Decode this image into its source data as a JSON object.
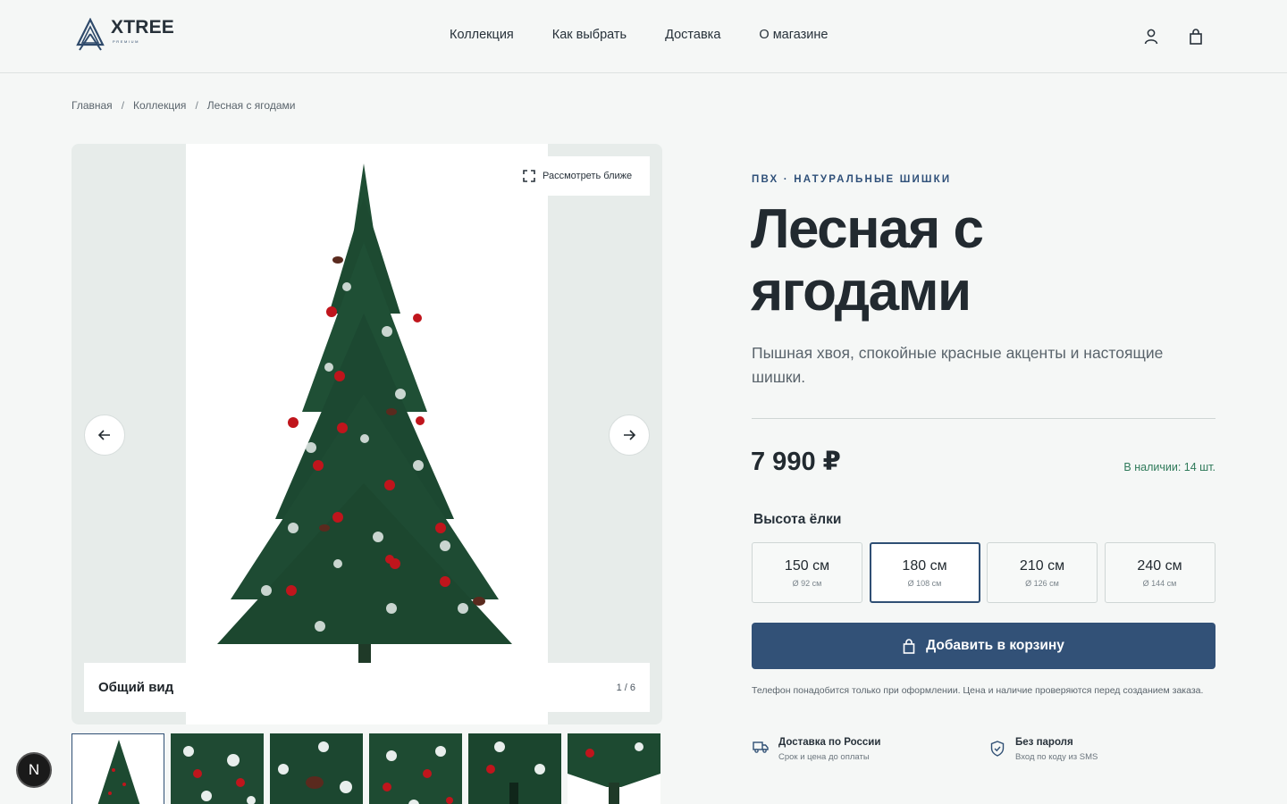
{
  "brand": {
    "name": "XTREE",
    "sub": "PREMIUM"
  },
  "nav": [
    {
      "label": "Коллекция"
    },
    {
      "label": "Как выбрать"
    },
    {
      "label": "Доставка"
    },
    {
      "label": "О магазине"
    }
  ],
  "header_icons": [
    "user-icon",
    "bag-icon"
  ],
  "breadcrumb": [
    "Главная",
    "Коллекция",
    "Лесная с ягодами"
  ],
  "gallery": {
    "zoom_label": "Рассмотреть ближе",
    "caption": "Общий вид",
    "counter": "1 / 6",
    "thumbnail_count": 6
  },
  "product": {
    "category": "ПВХ · натуральные шишки",
    "title_line1": "Лесная с",
    "title_line2": "ягодами",
    "subtitle": "Пышная хвоя, спокойные красные акценты и настоящие шишки.",
    "price": "7 990 ₽",
    "stock": "В наличии: 14 шт.",
    "height_label": "Высота ёлки",
    "sizes": [
      {
        "label": "150 см",
        "diameter": "Ø 92 см",
        "selected": false
      },
      {
        "label": "180 см",
        "diameter": "Ø 108 см",
        "selected": true
      },
      {
        "label": "210 см",
        "diameter": "Ø 126 см",
        "selected": false
      },
      {
        "label": "240 см",
        "diameter": "Ø 144 см",
        "selected": false
      }
    ],
    "cart_button": "Добавить в корзину",
    "note": "Телефон понадобится только при оформлении. Цена и наличие проверяются перед созданием заказа."
  },
  "features": [
    {
      "title": "Доставка по России",
      "sub": "Срок и цена до оплаты",
      "icon": "truck-icon"
    },
    {
      "title": "Без пароля",
      "sub": "Вход по коду из SMS",
      "icon": "shield-check-icon"
    }
  ],
  "dev_badge": "N",
  "colors": {
    "accent": "#325177",
    "stock": "#2f7a5a",
    "tree": "#1d4a33",
    "berry": "#c0151c"
  }
}
